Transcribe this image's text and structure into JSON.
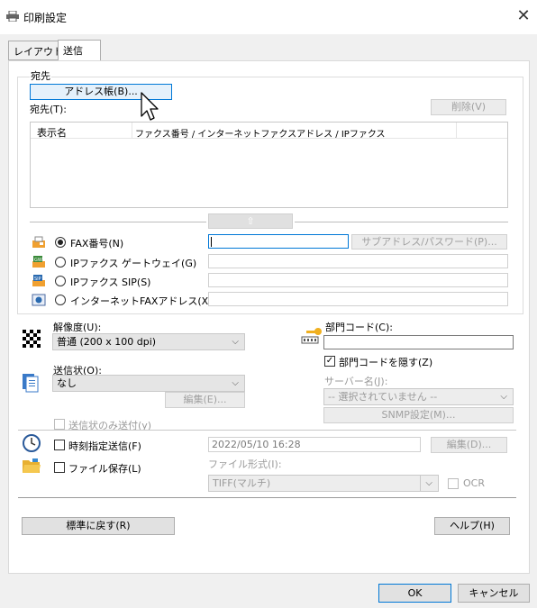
{
  "window": {
    "title": "印刷設定",
    "close": "✕"
  },
  "tabs": [
    {
      "label": "レイアウト"
    },
    {
      "label": "送信"
    }
  ],
  "destination": {
    "group_label": "宛先",
    "address_book_button": "アドレス帳(B)...",
    "list_label": "宛先(T):",
    "delete_button": "削除(V)",
    "columns": {
      "name": "表示名",
      "number": "ファクス番号 / インターネットファクスアドレス / IPファクス"
    }
  },
  "send_types": [
    {
      "label": "FAX番号(N)",
      "selected": true,
      "value": ""
    },
    {
      "label": "IPファクス ゲートウェイ(G)",
      "selected": false,
      "value": ""
    },
    {
      "label": "IPファクス SIP(S)",
      "selected": false,
      "value": ""
    },
    {
      "label": "インターネットFAXアドレス(X)",
      "selected": false,
      "value": ""
    }
  ],
  "subaddress_button": "サブアドレス/パスワード(P)...",
  "resolution": {
    "label": "解像度(U):",
    "value": "普通 (200 x 100 dpi)"
  },
  "cover": {
    "label": "送信状(O):",
    "value": "なし",
    "edit_button": "編集(E)...",
    "only_cover_label": "送信状のみ送付(y)"
  },
  "department": {
    "label": "部門コード(C):",
    "value": "",
    "hide_label": "部門コードを隠す(Z)",
    "hide_checked": true
  },
  "server": {
    "label": "サーバー名(J):",
    "value": "-- 選択されていません --",
    "snmp_button": "SNMP設定(M)..."
  },
  "schedule": {
    "label": "時刻指定送信(F)",
    "datetime": "2022/05/10 16:28",
    "edit_button": "編集(D)..."
  },
  "file_save": {
    "label": "ファイル保存(L)",
    "format_label": "ファイル形式(I):",
    "format_value": "TIFF(マルチ)",
    "ocr_label": "OCR"
  },
  "reset_button": "標準に戻す(R)",
  "help_button": "ヘルプ(H)",
  "ok_button": "OK",
  "cancel_button": "キャンセル",
  "colors": {
    "accent": "#0078d7",
    "disabled_text": "#a0a0a0"
  }
}
